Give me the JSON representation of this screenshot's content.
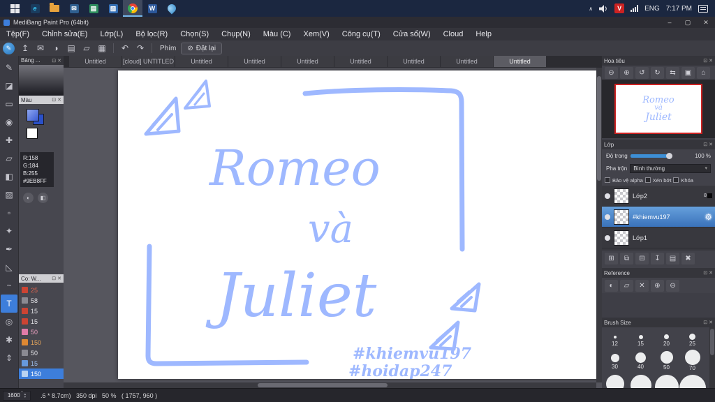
{
  "colors": {
    "ink": "#9EB8FF",
    "selection": "#3d8fd6",
    "thumb_border": "#cc2222"
  },
  "taskbar": {
    "time": "7:17 PM",
    "language": "ENG",
    "tray_v": "V",
    "chevron": "∧"
  },
  "titlebar": {
    "title": "MediBang Paint Pro (64bit)"
  },
  "menubar": {
    "items": [
      "Tệp(F)",
      "Chỉnh sửa(E)",
      "Lớp(L)",
      "Bộ lọc(R)",
      "Chọn(S)",
      "Chụp(N)",
      "Màu (C)",
      "Xem(V)",
      "Công cụ(T)",
      "Cửa sổ(W)",
      "Cloud",
      "Help"
    ]
  },
  "toolbar": {
    "phim": "Phím",
    "reset": "Đặt lại"
  },
  "tabs": [
    "Untitled",
    "[cloud] UNTITLED",
    "Untitled",
    "Untitled",
    "Untitled",
    "Untitled",
    "Untitled",
    "Untitled",
    "Untitled"
  ],
  "tool_glyphs": [
    "✎",
    "◪",
    "▭",
    "◉",
    "✚",
    "▱",
    "◧",
    "▨",
    "▫",
    "✦",
    "✒",
    "◺",
    "~",
    "T",
    "◎",
    "✱",
    "⇕"
  ],
  "left_panel": {
    "palette_header": "Bảng ...",
    "color_header": "Màu",
    "rgb": {
      "r": "R:158",
      "g": "G:184",
      "b": "B:255",
      "hex": "#9EB8FF"
    },
    "brush_header": "Cọ: W...",
    "brushes": [
      {
        "label": "25",
        "label_color": "#e0644f",
        "icon_color": "#cc4433"
      },
      {
        "label": "58",
        "label_color": "#e4e4e8",
        "icon_color": "#8a8a92"
      },
      {
        "label": "15",
        "label_color": "#e4e4e8",
        "icon_color": "#cc4433"
      },
      {
        "label": "15",
        "label_color": "#e4e4e8",
        "icon_color": "#cc4433"
      },
      {
        "label": "50",
        "label_color": "#eba0c0",
        "icon_color": "#e07ba8"
      },
      {
        "label": "150",
        "label_color": "#e8a75c",
        "icon_color": "#dd8833"
      },
      {
        "label": "50",
        "label_color": "#e4e4e8",
        "icon_color": "#8a8a92"
      },
      {
        "label": "15",
        "label_color": "#9dc1f2",
        "icon_color": "#6699dd"
      },
      {
        "label": "150",
        "label_color": "#ffffff",
        "icon_color": "#b9d3f2",
        "selected": true
      }
    ]
  },
  "canvas": {
    "title_line1": "Romeo",
    "title_line2": "và",
    "title_line3": "Juliet",
    "watermark_line1": "#khiemvu197",
    "watermark_line2": "#hoidap247"
  },
  "navigator": {
    "title": "Hoa tiêu"
  },
  "layers": {
    "title": "Lớp",
    "opacity_label": "Độ trong",
    "opacity_value": "100 %",
    "blend_label": "Pha trộn",
    "blend_value": "Bình thường",
    "check1": "Bảo vệ alpha",
    "check2": "Xén bớt",
    "check3": "Khóa",
    "rows": [
      {
        "name": "Lớp2",
        "badge": "8"
      },
      {
        "name": "#khiemvu197",
        "selected": true
      },
      {
        "name": "Lớp1"
      }
    ]
  },
  "reference": {
    "title": "Reference"
  },
  "brush_size": {
    "title": "Brush Size",
    "labels_row1": [
      "12",
      "15",
      "20",
      "25"
    ],
    "labels_row2": [
      "30",
      "40",
      "50",
      "70"
    ]
  },
  "statusbar": {
    "zoom": "1600",
    "degree": "˚",
    "info": ".6 * 8.7cm)   350 dpi   50 %   ( 1757, 960 )"
  },
  "icons": {
    "minimize": "–",
    "maximize": "▢",
    "close": "✕",
    "export": "↥",
    "message": "✉",
    "palette": "◑",
    "doc": "▤",
    "pages": "▱",
    "grid": "▦",
    "undo": "↶",
    "redo": "↷",
    "no_entry": "⊘",
    "float": "⊡",
    "panel_close": "✕",
    "zoom_out": "⊖",
    "zoom_in": "⊕",
    "rotate_left": "↺",
    "rotate_right": "↻",
    "flip": "⇆",
    "fit": "▣",
    "home": "⌂",
    "gear": "⚙",
    "new_layer": "⊞",
    "dup_layer": "⧉",
    "sub_layer": "⊟",
    "merge_down": "↧",
    "layer_folder": "▤",
    "trash": "✖",
    "ref_color": "◐",
    "ref_folder": "▱",
    "ref_close": "✕",
    "ref_zoom_in": "⊕",
    "ref_zoom_out": "⊖",
    "swatch_a": "◐",
    "swatch_b": "◧",
    "caret_down": "▾",
    "spin_up": "▴",
    "spin_down": "▾"
  }
}
